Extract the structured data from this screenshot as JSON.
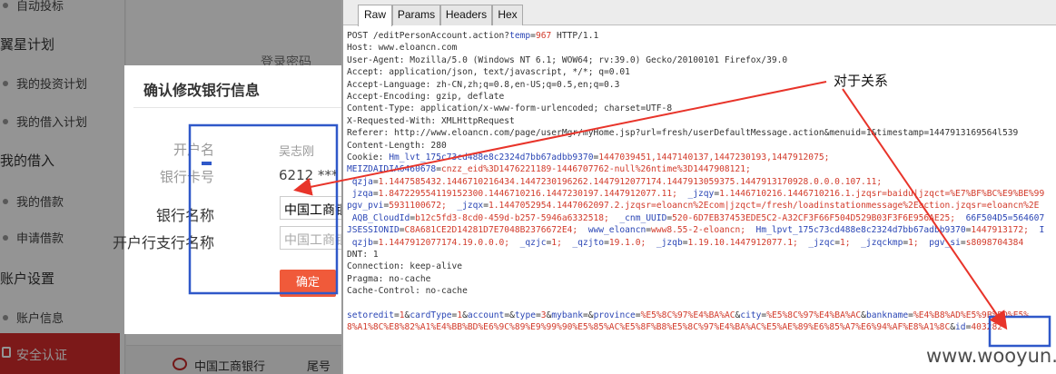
{
  "sidebar": {
    "items": [
      {
        "label": "自动投标",
        "kind": "item"
      },
      {
        "label": "翼星计划",
        "kind": "group"
      },
      {
        "label": "我的投资计划",
        "kind": "item"
      },
      {
        "label": "我的借入计划",
        "kind": "item"
      },
      {
        "label": "我的借入",
        "kind": "group"
      },
      {
        "label": "我的借款",
        "kind": "item"
      },
      {
        "label": "申请借款",
        "kind": "item"
      },
      {
        "label": "账户设置",
        "kind": "group"
      },
      {
        "label": "账户信息",
        "kind": "item"
      }
    ],
    "active_item": "安全认证",
    "active_color": "#d62b2b"
  },
  "page": {
    "login_password_text": "登录密码",
    "bottom_bank": "中国工商银行",
    "bottom_tail": "尾号"
  },
  "modal": {
    "title": "确认修改银行信息",
    "holder_label": "开户名",
    "holder_value": "吴志刚",
    "card_label": "银行卡号",
    "card_value": "6212 ***",
    "bank_label": "银行名称",
    "bank_value": "中国工商银行",
    "branch_label": "开户行支行名称",
    "branch_placeholder": "中国工商银行",
    "confirm_label": "确定",
    "confirm_color": "#f05a3a"
  },
  "viewer": {
    "tabs": [
      "Raw",
      "Params",
      "Headers",
      "Hex"
    ],
    "active_tab": "Raw",
    "lines": [
      [
        {
          "t": "POST /editPersonAccount.action?",
          "c": "k"
        },
        {
          "t": "temp",
          "c": "b"
        },
        {
          "t": "=",
          "c": "k"
        },
        {
          "t": "967",
          "c": "r"
        },
        {
          "t": " HTTP/1.1",
          "c": "k"
        }
      ],
      [
        {
          "t": "Host: www.eloancn.com",
          "c": "k"
        }
      ],
      [
        {
          "t": "User-Agent: Mozilla/5.0 (Windows NT 6.1; WOW64; rv:39.0) Gecko/20100101 Firefox/39.0",
          "c": "k"
        }
      ],
      [
        {
          "t": "Accept: application/json, text/javascript, */*; q=0.01",
          "c": "k"
        }
      ],
      [
        {
          "t": "Accept-Language: zh-CN,zh;q=0.8,en-US;q=0.5,en;q=0.3",
          "c": "k"
        }
      ],
      [
        {
          "t": "Accept-Encoding: gzip, deflate",
          "c": "k"
        }
      ],
      [
        {
          "t": "Content-Type: application/x-www-form-urlencoded; charset=UTF-8",
          "c": "k"
        }
      ],
      [
        {
          "t": "X-Requested-With: XMLHttpRequest",
          "c": "k"
        }
      ],
      [
        {
          "t": "Referer: http://www.eloancn.com/page/userMgr/myHome.jsp?url=fresh/userDefaultMessage.action&menuid=1&timestamp=1447913169564l539",
          "c": "k"
        }
      ],
      [
        {
          "t": "Content-Length: 280",
          "c": "k"
        }
      ],
      [
        {
          "t": "Cookie: ",
          "c": "k"
        },
        {
          "t": "Hm_lvt_175c73cd488e8c2324d7bb67adbb9370",
          "c": "b"
        },
        {
          "t": "=",
          "c": "k"
        },
        {
          "t": "1447039451,1447140137,1447230193,1447912075;",
          "c": "r"
        }
      ],
      [
        {
          "t": "MEIZDAIDIA6460678",
          "c": "b"
        },
        {
          "t": "=",
          "c": "k"
        },
        {
          "t": "cnzz_eid%3D1476221189-1446707762-null%26ntime%3D1447908121;",
          "c": "r"
        }
      ],
      [
        {
          "t": " qzja",
          "c": "b"
        },
        {
          "t": "=",
          "c": "k"
        },
        {
          "t": "1.1447585432.1446710216434.1447230196262.1447912077174.1447913059375.1447913170928.0.0.0.107.11;",
          "c": "r"
        }
      ],
      [
        {
          "t": " jzqa",
          "c": "b"
        },
        {
          "t": "=",
          "c": "k"
        },
        {
          "t": "1.847229554119152300.1446710216.1447230197.1447912077.11;",
          "c": "r"
        },
        {
          "t": "  _jzqy",
          "c": "b"
        },
        {
          "t": "=",
          "c": "k"
        },
        {
          "t": "1.1446710216.1446710216.1.jzqsr=baidu|jzqct=%E7%BF%BC%E9%BE%99",
          "c": "r"
        }
      ],
      [
        {
          "t": "pgv_pvi",
          "c": "b"
        },
        {
          "t": "=",
          "c": "k"
        },
        {
          "t": "5931100672;",
          "c": "r"
        },
        {
          "t": "  _jzqx",
          "c": "b"
        },
        {
          "t": "=",
          "c": "k"
        },
        {
          "t": "1.1447052954.1447062097.2.jzqsr=eloancn%2Ecom|jzqct=/fresh/loadinstationmessage%2Eaction.jzqsr=eloancn%2E",
          "c": "r"
        }
      ],
      [
        {
          "t": " AQB_CloudId",
          "c": "b"
        },
        {
          "t": "=",
          "c": "k"
        },
        {
          "t": "b12c5fd3-8cd0-459d-b257-5946a6332518;",
          "c": "r"
        },
        {
          "t": "  _cnm_UUID",
          "c": "b"
        },
        {
          "t": "=",
          "c": "k"
        },
        {
          "t": "520-6D7EB37453EDE5C2-A32CF3F66F504D529B03F3F6E956AE25;",
          "c": "r"
        },
        {
          "t": "  66F504D5=564607",
          "c": "b"
        }
      ],
      [
        {
          "t": "JSESSIONID",
          "c": "b"
        },
        {
          "t": "=",
          "c": "k"
        },
        {
          "t": "C8A681CE2D14281D7E7048B2376672E4;",
          "c": "r"
        },
        {
          "t": "  www_eloancn",
          "c": "b"
        },
        {
          "t": "=",
          "c": "k"
        },
        {
          "t": "www8.55-2-eloancn;",
          "c": "r"
        },
        {
          "t": "  Hm_lpvt_175c73cd488e8c2324d7bb67adbb9370",
          "c": "b"
        },
        {
          "t": "=",
          "c": "k"
        },
        {
          "t": "1447913172;",
          "c": "r"
        },
        {
          "t": "  I",
          "c": "b"
        }
      ],
      [
        {
          "t": " qzjb",
          "c": "b"
        },
        {
          "t": "=",
          "c": "k"
        },
        {
          "t": "1.1447912077174.19.0.0.0;",
          "c": "r"
        },
        {
          "t": "  _qzjc",
          "c": "b"
        },
        {
          "t": "=",
          "c": "k"
        },
        {
          "t": "1;",
          "c": "r"
        },
        {
          "t": "  _qzjto",
          "c": "b"
        },
        {
          "t": "=",
          "c": "k"
        },
        {
          "t": "19.1.0;",
          "c": "r"
        },
        {
          "t": "  _jzqb",
          "c": "b"
        },
        {
          "t": "=",
          "c": "k"
        },
        {
          "t": "1.19.10.1447912077.1;",
          "c": "r"
        },
        {
          "t": "  _jzqc",
          "c": "b"
        },
        {
          "t": "=",
          "c": "k"
        },
        {
          "t": "1;",
          "c": "r"
        },
        {
          "t": "  _jzqckmp",
          "c": "b"
        },
        {
          "t": "=",
          "c": "k"
        },
        {
          "t": "1;",
          "c": "r"
        },
        {
          "t": "  pgv_si",
          "c": "b"
        },
        {
          "t": "=",
          "c": "k"
        },
        {
          "t": "s8098704384",
          "c": "r"
        }
      ],
      [
        {
          "t": "DNT: 1",
          "c": "k"
        }
      ],
      [
        {
          "t": "Connection: keep-alive",
          "c": "k"
        }
      ],
      [
        {
          "t": "Pragma: no-cache",
          "c": "k"
        }
      ],
      [
        {
          "t": "Cache-Control: no-cache",
          "c": "k"
        }
      ],
      [
        {
          "t": "",
          "c": "k"
        }
      ],
      [
        {
          "t": "setoredit",
          "c": "b"
        },
        {
          "t": "=",
          "c": "k"
        },
        {
          "t": "1",
          "c": "r"
        },
        {
          "t": "&",
          "c": "k"
        },
        {
          "t": "cardType",
          "c": "b"
        },
        {
          "t": "=",
          "c": "k"
        },
        {
          "t": "1",
          "c": "r"
        },
        {
          "t": "&",
          "c": "k"
        },
        {
          "t": "account",
          "c": "b"
        },
        {
          "t": "=&",
          "c": "k"
        },
        {
          "t": "type",
          "c": "b"
        },
        {
          "t": "=",
          "c": "k"
        },
        {
          "t": "3",
          "c": "r"
        },
        {
          "t": "&",
          "c": "k"
        },
        {
          "t": "mybank",
          "c": "b"
        },
        {
          "t": "=&",
          "c": "k"
        },
        {
          "t": "province",
          "c": "b"
        },
        {
          "t": "=",
          "c": "k"
        },
        {
          "t": "%E5%8C%97%E4%BA%AC",
          "c": "r"
        },
        {
          "t": "&",
          "c": "k"
        },
        {
          "t": "city",
          "c": "b"
        },
        {
          "t": "=",
          "c": "k"
        },
        {
          "t": "%E5%8C%97%E4%BA%AC",
          "c": "r"
        },
        {
          "t": "&",
          "c": "k"
        },
        {
          "t": "bankname",
          "c": "b"
        },
        {
          "t": "=",
          "c": "k"
        },
        {
          "t": "%E4%B8%AD%E5%9B%BD%E5%",
          "c": "r"
        }
      ],
      [
        {
          "t": "8%A1%8C%E8%82%A1%E4%BB%BD%E6%9C%89%E9%99%90%E5%85%AC%E5%8F%B8%E5%8C%97%E4%BA%AC%E5%AE%89%E6%85%A7%E6%94%AF%E8%A1%8C",
          "c": "r"
        },
        {
          "t": "&",
          "c": "k"
        },
        {
          "t": "id",
          "c": "b"
        },
        {
          "t": "=",
          "c": "k"
        },
        {
          "t": "403282",
          "c": "r"
        }
      ]
    ]
  },
  "annotation": {
    "label": "对于关系",
    "arrow_color": "#e8342a",
    "box_color": "#2f58c9"
  },
  "watermark": "www.wooyun.org"
}
